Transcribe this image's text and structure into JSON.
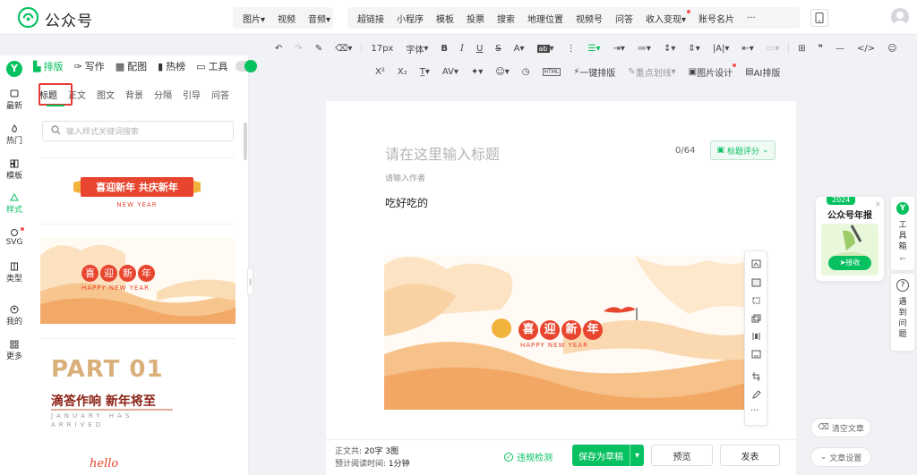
{
  "header": {
    "brand": "公众号",
    "groups": [
      [
        "图片",
        "视频",
        "音频"
      ],
      [
        "超链接",
        "小程序",
        "模板",
        "投票",
        "搜索",
        "地理位置",
        "视频号",
        "问答",
        "收入变现",
        "账号名片",
        "···"
      ]
    ]
  },
  "toolbar": {
    "font_size": "17px",
    "font_family": "字体",
    "bold": "B",
    "italic": "I",
    "underline": "U",
    "strike": "S",
    "quote": "❞",
    "row2": {
      "sup": "X²",
      "sub": "X₂",
      "one_click": "一键排版",
      "highlight": "重点划线",
      "img_design": "图片设计",
      "ai": "AI排版"
    }
  },
  "rail": {
    "items": [
      {
        "label": "最新",
        "icon": "ai-chat-icon"
      },
      {
        "label": "热门",
        "icon": "fire-icon"
      },
      {
        "label": "模板",
        "icon": "template-icon"
      },
      {
        "label": "样式",
        "icon": "style-icon"
      },
      {
        "label": "SVG",
        "icon": "svg-icon"
      },
      {
        "label": "类型",
        "icon": "type-icon"
      },
      {
        "label": "我的",
        "icon": "user-icon"
      },
      {
        "label": "更多",
        "icon": "more-icon"
      }
    ]
  },
  "panel": {
    "tabs": [
      {
        "label": "排版",
        "icon": "layout-icon"
      },
      {
        "label": "写作",
        "icon": "write-icon"
      },
      {
        "label": "配图",
        "icon": "image-icon"
      },
      {
        "label": "热榜",
        "icon": "rank-icon"
      },
      {
        "label": "工具",
        "icon": "tool-icon"
      }
    ],
    "subtabs": [
      "标题",
      "正文",
      "图文",
      "背景",
      "分隔",
      "引导",
      "问答"
    ],
    "search_placeholder": "输入样式关键词搜索",
    "card1": {
      "title": "喜迎新年 共庆新年",
      "sub": "NEW YEAR"
    },
    "card2": {
      "chars": [
        "喜",
        "迎",
        "新",
        "年"
      ],
      "sub": "HAPPY NEW YEAR"
    },
    "card3": {
      "part": "PART 01",
      "title": "滴答作响 新年将至",
      "sub1": "JANUARY HAS",
      "sub2": "ARRIVED"
    },
    "card4": {
      "text": "hello"
    }
  },
  "editor": {
    "title_placeholder": "请在这里输入标题",
    "counter": "0/64",
    "score_button": "标题评分",
    "author_placeholder": "请输入作者",
    "body_text": "吃好吃的",
    "banner": {
      "chars": [
        "喜",
        "迎",
        "新",
        "年"
      ],
      "sub": "HAPPY NEW YEAR"
    }
  },
  "footer": {
    "wordcount_label": "正文共:",
    "wordcount_value": "20字 3图",
    "readtime_label": "预计阅读时间:",
    "readtime_value": "1分钟",
    "violation": "违规检测",
    "save": "保存为草稿",
    "preview": "预览",
    "publish": "发表"
  },
  "side": {
    "promo_year": "2024",
    "promo_title": "公众号年报",
    "promo_button": "接收",
    "toolbox": [
      "工",
      "具",
      "箱"
    ],
    "help": [
      "遇",
      "到",
      "问",
      "题"
    ],
    "clear": "清空文章",
    "settings": "文章设置"
  },
  "colors": {
    "accent": "#07c160",
    "red": "#e53935",
    "festive": "#e8452f",
    "cloud": "#f6c38a"
  }
}
